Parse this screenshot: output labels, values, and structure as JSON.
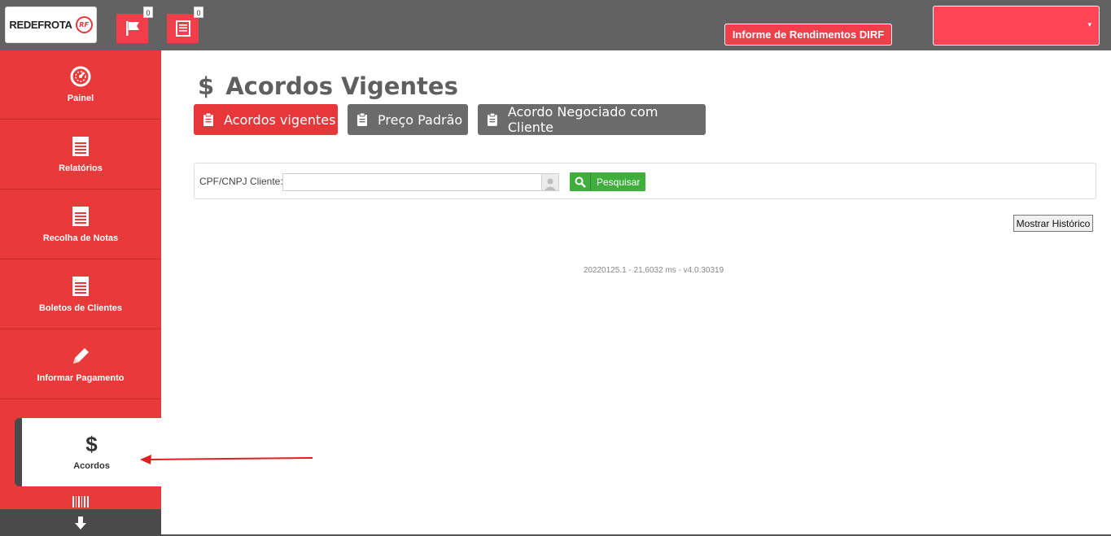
{
  "header": {
    "logo_text": "REDEFROTA",
    "logo_badge": "RF",
    "flags_count": "0",
    "docs_count": "0",
    "dirf_button": "Informe de Rendimentos DIRF",
    "user_caret": "▾"
  },
  "sidebar": {
    "items": [
      {
        "label": "Painel",
        "icon": "dashboard-gauge-icon"
      },
      {
        "label": "Relatórios",
        "icon": "document-list-icon"
      },
      {
        "label": "Recolha de Notas",
        "icon": "document-list-icon"
      },
      {
        "label": "Boletos de Clientes",
        "icon": "document-list-icon"
      },
      {
        "label": "Informar Pagamento",
        "icon": "pencil-icon"
      },
      {
        "label": "Acordos",
        "icon": "dollar-icon",
        "active": true
      }
    ],
    "scroll_icon": "arrow-down-icon"
  },
  "page": {
    "title_symbol": "$",
    "title": "Acordos Vigentes",
    "tabs": [
      {
        "label": "Acordos vigentes",
        "active": true
      },
      {
        "label": "Preço Padrão",
        "active": false
      },
      {
        "label": "Acordo Negociado com Cliente",
        "active": false
      }
    ]
  },
  "filter": {
    "label": "CPF/CNPJ Cliente:",
    "value": "",
    "search_label": "Pesquisar"
  },
  "history_button": "Mostrar Histórico",
  "footer_version": "20220125.1 - 21,6032 ms - v4.0.30319",
  "colors": {
    "topbar": "#626262",
    "sidebar": "#e83a3a",
    "accent_red": "#e8373a",
    "tab_gray": "#6b6b6b",
    "search_green": "#3fae3c"
  }
}
